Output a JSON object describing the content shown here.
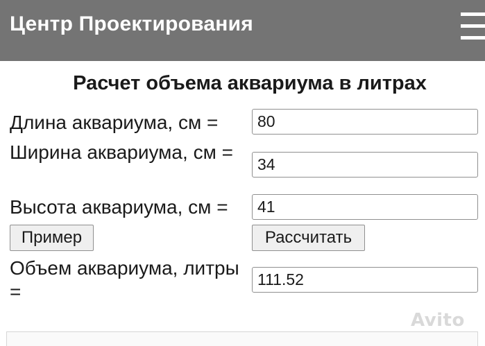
{
  "header": {
    "title": "Центр Проектирования",
    "menu_icon": "hamburger-menu-icon"
  },
  "calculator": {
    "title": "Расчет объема аквариума в литрах",
    "length_label": "Длина аквариума, см =",
    "length_value": "80",
    "width_label": "Ширина аквариума, см =",
    "width_value": "34",
    "height_label": "Высота аквариума, см =",
    "height_value": "41",
    "example_button": "Пример",
    "calculate_button": "Рассчитать",
    "volume_label": "Объем аквариума, литры =",
    "volume_value": "111.52"
  },
  "watermark": {
    "text": "Avito"
  },
  "colors": {
    "header_bg": "#747474",
    "header_text": "#ffffff"
  }
}
